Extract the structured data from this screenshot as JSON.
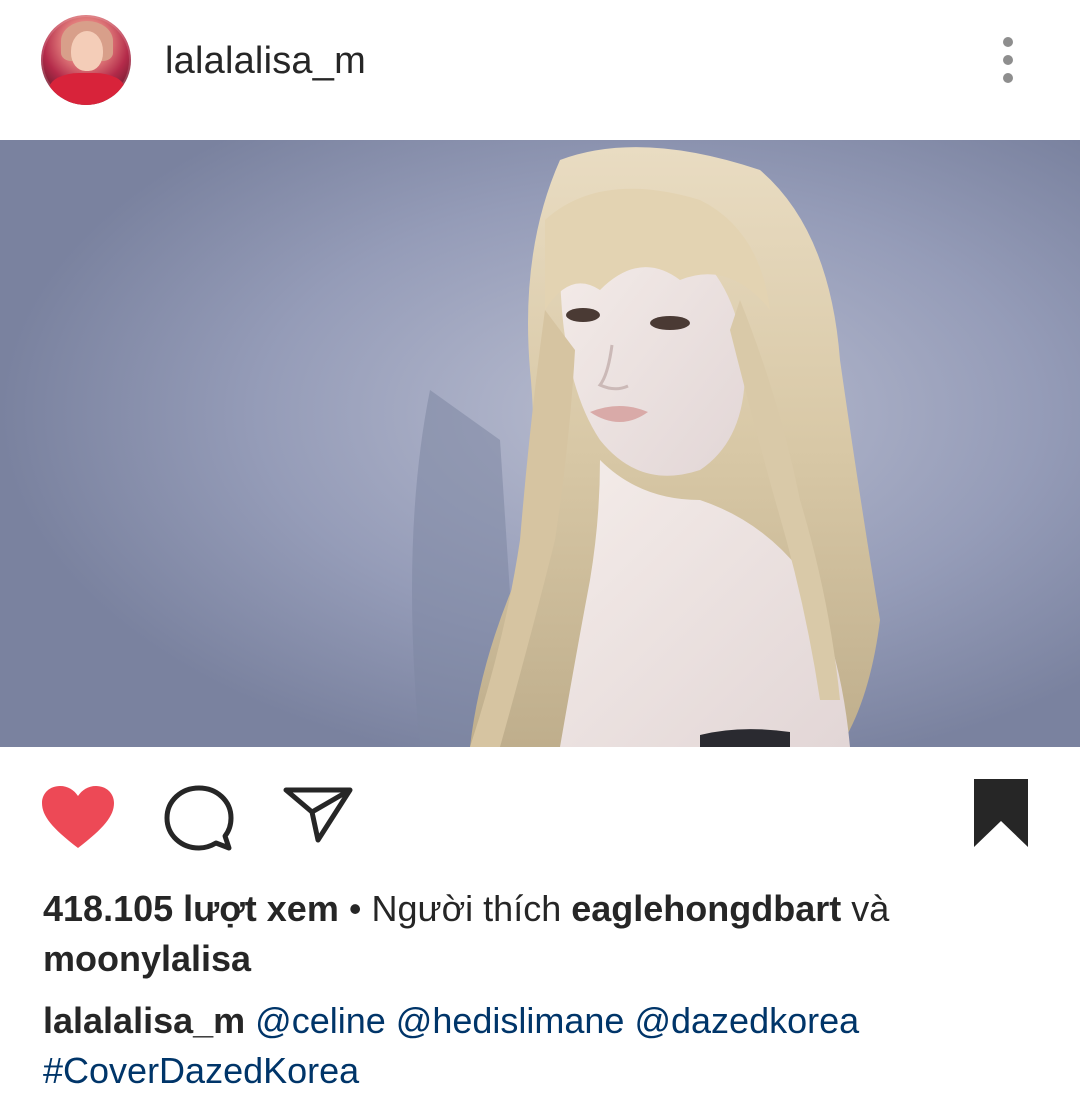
{
  "post": {
    "username": "lalalalisa_m",
    "more_icon": "more-vertical-icon"
  },
  "actions": {
    "like_icon": "heart-filled-icon",
    "like_color": "#ed4956",
    "comment_icon": "comment-icon",
    "share_icon": "send-icon",
    "save_icon": "bookmark-filled-icon"
  },
  "stats": {
    "views": "418.105 lượt xem",
    "separator": " • ",
    "liked_by_prefix": "Người thích ",
    "liked_by_user1": "eaglehongdbart",
    "liked_by_and": " và",
    "liked_by_user2": "moonylalisa"
  },
  "caption": {
    "username": "lalalalisa_m",
    "mention1": "@celine",
    "mention2": "@hedislimane",
    "mention3": "@dazedkorea",
    "hashtag": "#CoverDazedKorea"
  },
  "colors": {
    "text": "#262626",
    "link": "#003569",
    "icon": "#262626"
  }
}
